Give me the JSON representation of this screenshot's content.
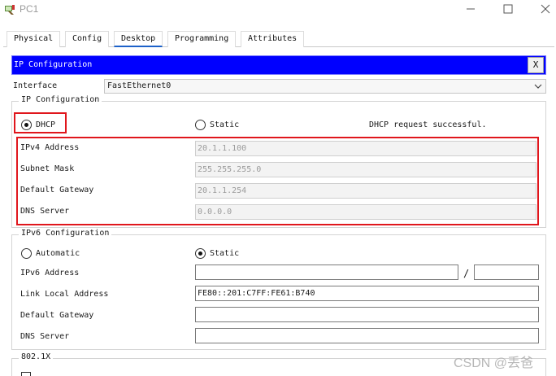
{
  "window": {
    "title": "PC1",
    "close_glyph": "✕"
  },
  "tabs": [
    {
      "label": "Physical",
      "active": false
    },
    {
      "label": "Config",
      "active": false
    },
    {
      "label": "Desktop",
      "active": true
    },
    {
      "label": "Programming",
      "active": false
    },
    {
      "label": "Attributes",
      "active": false
    }
  ],
  "ip_config": {
    "header_title": "IP Configuration",
    "close_label": "X",
    "interface_label": "Interface",
    "interface_value": "FastEthernet0",
    "ipv4_group_title": "IP Configuration",
    "dhcp_label": "DHCP",
    "dhcp_selected": true,
    "static_label": "Static",
    "static_selected": false,
    "status_text": "DHCP request successful.",
    "fields": [
      {
        "label": "IPv4 Address",
        "value": "20.1.1.100"
      },
      {
        "label": "Subnet Mask",
        "value": "255.255.255.0"
      },
      {
        "label": "Default Gateway",
        "value": "20.1.1.254"
      },
      {
        "label": "DNS Server",
        "value": "0.0.0.0"
      }
    ]
  },
  "ipv6_config": {
    "group_title": "IPv6 Configuration",
    "automatic_label": "Automatic",
    "automatic_selected": false,
    "static_label": "Static",
    "static_selected": true,
    "address_label": "IPv6 Address",
    "address_value": "",
    "prefix_separator": "/",
    "prefix_value": "",
    "link_local_label": "Link Local Address",
    "link_local_value": "FE80::201:C7FF:FE61:B740",
    "gateway_label": "Default Gateway",
    "gateway_value": "",
    "dns_label": "DNS Server",
    "dns_value": ""
  },
  "dot1x": {
    "group_title": "802.1X"
  },
  "watermark": "CSDN @丢爸",
  "colors": {
    "header_blue": "#0000ff",
    "highlight_red": "#e0161c",
    "tab_underline": "#1d61c9"
  }
}
